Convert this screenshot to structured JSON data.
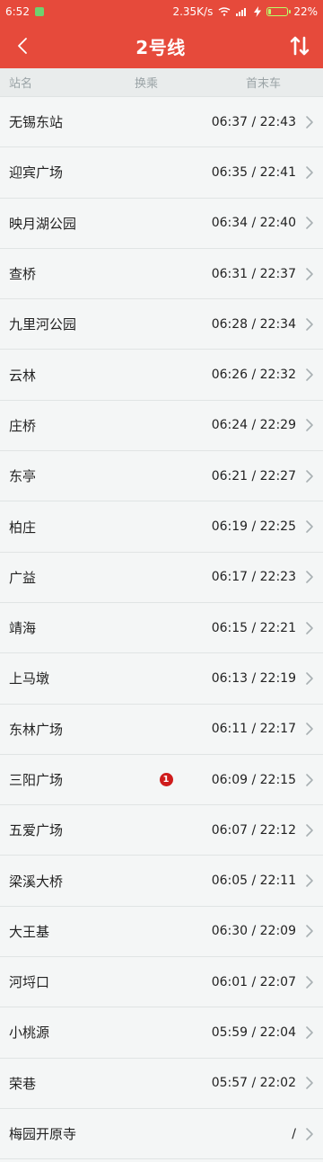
{
  "status_bar": {
    "time": "6:52",
    "speed": "2.35K/s",
    "battery": "22%",
    "battery_level": 0.22
  },
  "header": {
    "title": "2号线"
  },
  "columns": {
    "name": "站名",
    "transfer": "换乘",
    "time": "首末车"
  },
  "stations": [
    {
      "name": "无锡东站",
      "time": "06:37 / 22:43",
      "transfer": ""
    },
    {
      "name": "迎宾广场",
      "time": "06:35 / 22:41",
      "transfer": ""
    },
    {
      "name": "映月湖公园",
      "time": "06:34 / 22:40",
      "transfer": ""
    },
    {
      "name": "查桥",
      "time": "06:31 / 22:37",
      "transfer": ""
    },
    {
      "name": "九里河公园",
      "time": "06:28 / 22:34",
      "transfer": ""
    },
    {
      "name": "云林",
      "time": "06:26 / 22:32",
      "transfer": ""
    },
    {
      "name": "庄桥",
      "time": "06:24 / 22:29",
      "transfer": ""
    },
    {
      "name": "东亭",
      "time": "06:21 / 22:27",
      "transfer": ""
    },
    {
      "name": "柏庄",
      "time": "06:19 / 22:25",
      "transfer": ""
    },
    {
      "name": "广益",
      "time": "06:17 / 22:23",
      "transfer": ""
    },
    {
      "name": "靖海",
      "time": "06:15 / 22:21",
      "transfer": ""
    },
    {
      "name": "上马墩",
      "time": "06:13 / 22:19",
      "transfer": ""
    },
    {
      "name": "东林广场",
      "time": "06:11 / 22:17",
      "transfer": ""
    },
    {
      "name": "三阳广场",
      "time": "06:09 / 22:15",
      "transfer": "1"
    },
    {
      "name": "五爱广场",
      "time": "06:07 / 22:12",
      "transfer": ""
    },
    {
      "name": "梁溪大桥",
      "time": "06:05 / 22:11",
      "transfer": ""
    },
    {
      "name": "大王基",
      "time": "06:30 / 22:09",
      "transfer": ""
    },
    {
      "name": "河埒口",
      "time": "06:01 / 22:07",
      "transfer": ""
    },
    {
      "name": "小桃源",
      "time": "05:59 / 22:04",
      "transfer": ""
    },
    {
      "name": "荣巷",
      "time": "05:57 / 22:02",
      "transfer": ""
    },
    {
      "name": "梅园开原寺",
      "time": "/",
      "transfer": ""
    }
  ],
  "colors": {
    "brand_red": "#e64a3b",
    "transfer_badge": "#cf1c1c"
  }
}
